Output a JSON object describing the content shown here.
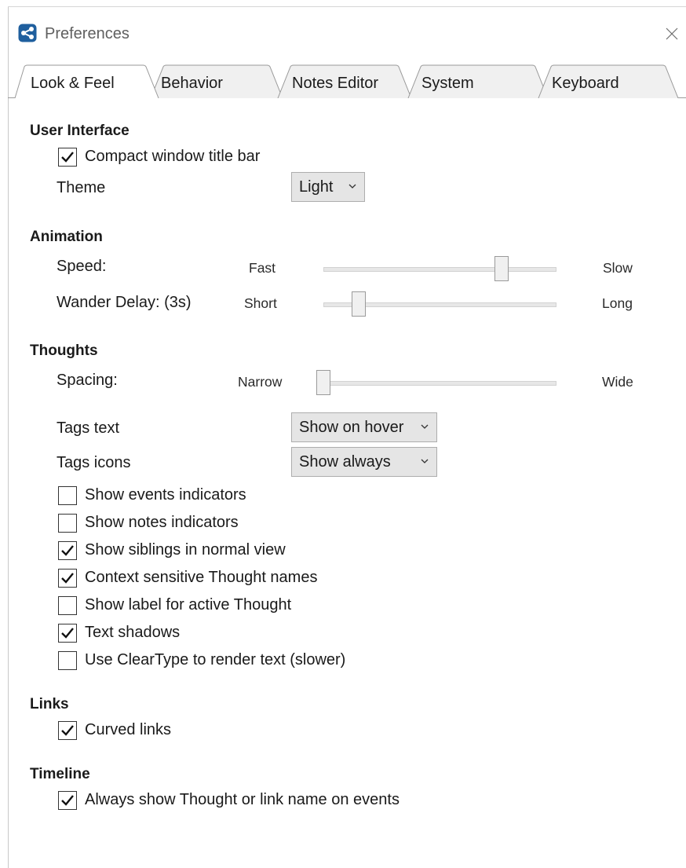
{
  "window": {
    "title": "Preferences"
  },
  "tabs": [
    {
      "label": "Look & Feel",
      "active": true
    },
    {
      "label": "Behavior",
      "active": false
    },
    {
      "label": "Notes Editor",
      "active": false
    },
    {
      "label": "System",
      "active": false
    },
    {
      "label": "Keyboard",
      "active": false
    }
  ],
  "user_interface": {
    "title": "User Interface",
    "compact_title_bar": {
      "label": "Compact window title bar",
      "checked": true
    },
    "theme": {
      "label": "Theme",
      "value": "Light"
    }
  },
  "animation": {
    "title": "Animation",
    "speed": {
      "label": "Speed:",
      "min_label": "Fast",
      "max_label": "Slow",
      "value_fraction": 0.78
    },
    "wander_delay": {
      "label": "Wander Delay: (3s)",
      "min_label": "Short",
      "max_label": "Long",
      "value_fraction": 0.13
    }
  },
  "thoughts": {
    "title": "Thoughts",
    "spacing": {
      "label": "Spacing:",
      "min_label": "Narrow",
      "max_label": "Wide",
      "value_fraction": 0.0
    },
    "tags_text": {
      "label": "Tags text",
      "value": "Show on hover"
    },
    "tags_icons": {
      "label": "Tags icons",
      "value": "Show always"
    },
    "options": [
      {
        "label": "Show events indicators",
        "checked": false
      },
      {
        "label": "Show notes indicators",
        "checked": false
      },
      {
        "label": "Show siblings in normal view",
        "checked": true
      },
      {
        "label": "Context sensitive Thought names",
        "checked": true
      },
      {
        "label": "Show label for active Thought",
        "checked": false
      },
      {
        "label": "Text shadows",
        "checked": true
      },
      {
        "label": "Use ClearType to render text (slower)",
        "checked": false
      }
    ]
  },
  "links": {
    "title": "Links",
    "curved_links": {
      "label": "Curved links",
      "checked": true
    }
  },
  "timeline": {
    "title": "Timeline",
    "always_show_names": {
      "label": "Always show Thought or link name on events",
      "checked": true
    }
  },
  "colors": {
    "app_icon": "#1f5f9e",
    "tab_active_bg": "#ffffff",
    "tab_inactive_bg": "#f0f0f0",
    "dropdown_bg": "#e5e5e5"
  },
  "icons": {
    "app": "thebrain-logo-icon",
    "close": "close-icon",
    "dropdown": "chevron-down-icon",
    "check": "checkmark-icon"
  }
}
